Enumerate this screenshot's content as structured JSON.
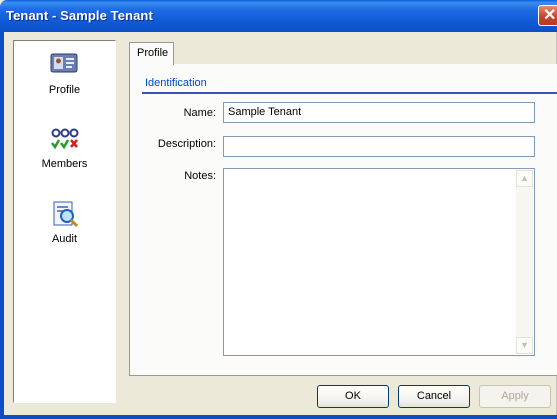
{
  "window": {
    "title": "Tenant - Sample Tenant"
  },
  "sidebar": {
    "items": [
      {
        "label": "Profile",
        "icon": "profile-icon",
        "selected": true
      },
      {
        "label": "Members",
        "icon": "members-icon",
        "selected": false
      },
      {
        "label": "Audit",
        "icon": "audit-icon",
        "selected": false
      }
    ]
  },
  "tabs": [
    {
      "label": "Profile",
      "active": true
    }
  ],
  "identification": {
    "group_title": "Identification",
    "name_label": "Name:",
    "name_value": "Sample Tenant",
    "description_label": "Description:",
    "description_value": "",
    "notes_label": "Notes:",
    "notes_value": ""
  },
  "buttons": {
    "ok": "OK",
    "cancel": "Cancel",
    "apply": "Apply"
  },
  "colors": {
    "title_bar": "#0c4fc5",
    "dialog_bg": "#ece9d8",
    "group_title": "#0046d5"
  }
}
